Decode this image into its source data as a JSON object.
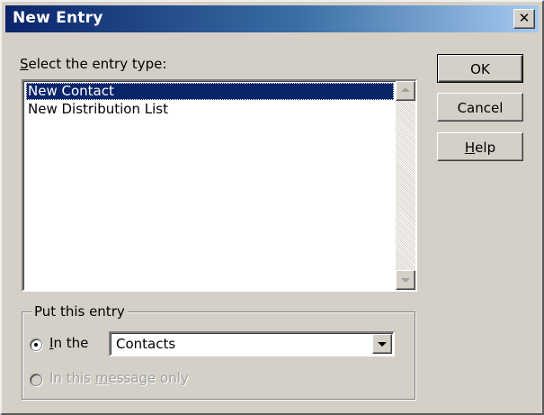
{
  "window": {
    "title": "New Entry",
    "close_glyph": "✕",
    "close_icon": "close-icon"
  },
  "entry_type": {
    "label_mnemonic": "S",
    "label_rest": "elect the entry type:",
    "items": [
      {
        "label": "New Contact",
        "selected": true
      },
      {
        "label": "New Distribution List",
        "selected": false
      }
    ]
  },
  "buttons": {
    "ok": "OK",
    "cancel": "Cancel",
    "help_mnemonic": "H",
    "help_rest": "elp"
  },
  "put_entry": {
    "legend": "Put this entry",
    "in_the_mnemonic": "I",
    "in_the_rest": "n the",
    "folder_value": "Contacts",
    "message_only_pre": "In this ",
    "message_only_mnemonic": "m",
    "message_only_post": "essage only"
  },
  "colors": {
    "titlebar_start": "#0a246a",
    "titlebar_end": "#a6caf0",
    "selection": "#0a246a",
    "face": "#d4d0c8"
  }
}
